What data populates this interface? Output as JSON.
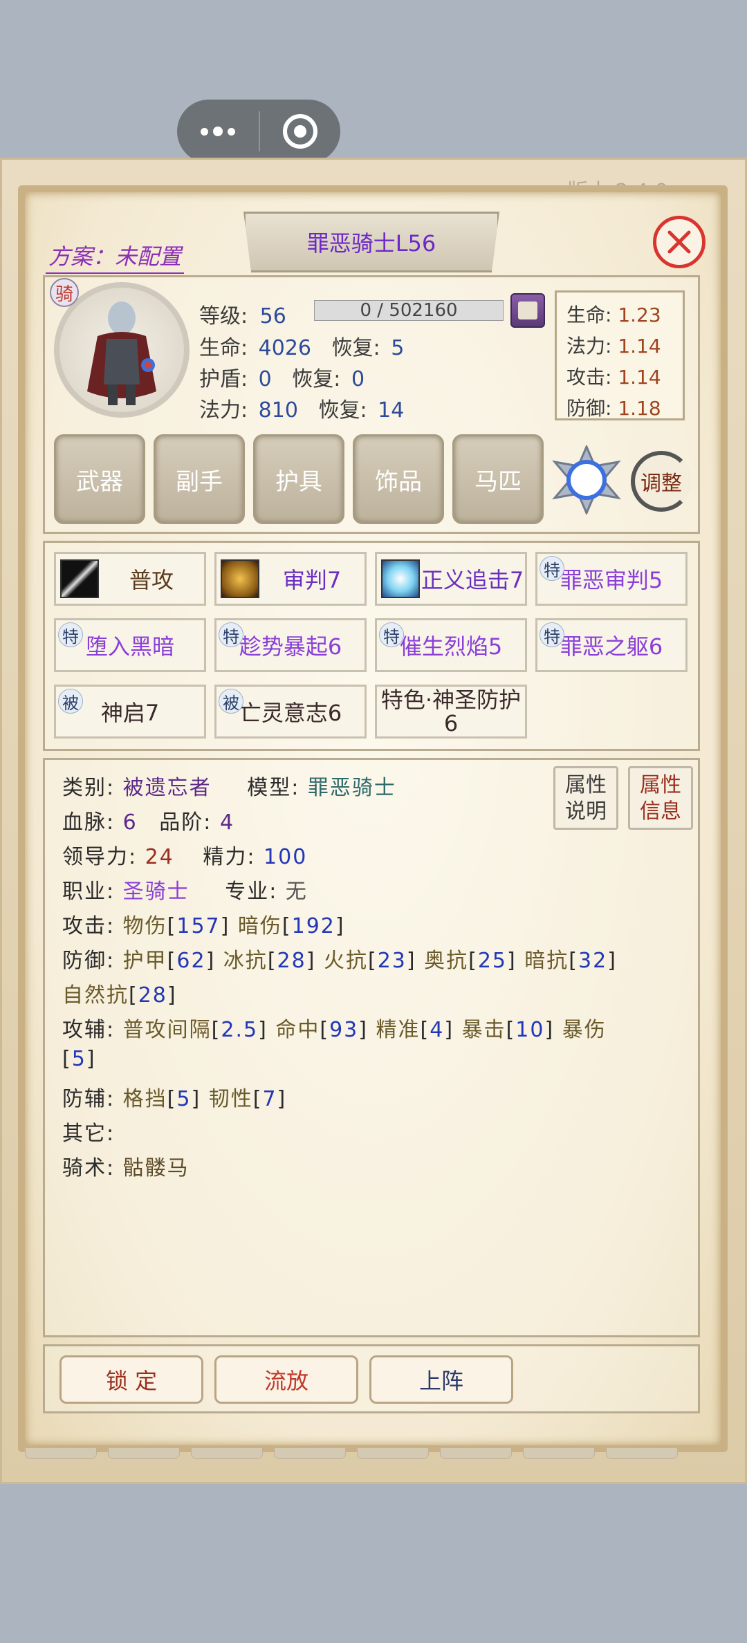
{
  "version_hint": "版本 2.4.0",
  "title": "罪恶骑士L56",
  "plan_label": "方案：未配置",
  "class_badge": "骑",
  "stats": {
    "level_label": "等级:",
    "level": "56",
    "exp": "0 / 502160",
    "hp_label": "生命:",
    "hp": "4026",
    "hp_regen_label": "恢复:",
    "hp_regen": "5",
    "shield_label": "护盾:",
    "shield": "0",
    "shield_regen_label": "恢复:",
    "shield_regen": "0",
    "mp_label": "法力:",
    "mp": "810",
    "mp_regen_label": "恢复:",
    "mp_regen": "14"
  },
  "growth": [
    {
      "label": "生命:",
      "value": "1.23"
    },
    {
      "label": "法力:",
      "value": "1.14"
    },
    {
      "label": "攻击:",
      "value": "1.14"
    },
    {
      "label": "防御:",
      "value": "1.18"
    }
  ],
  "equipment": [
    "武器",
    "副手",
    "护具",
    "饰品",
    "马匹"
  ],
  "adjust_label": "调整",
  "skills": [
    {
      "tag": "",
      "icon": "sword-icon",
      "label": "普攻"
    },
    {
      "tag": "",
      "icon": "judgement-icon",
      "label": "审判7"
    },
    {
      "tag": "",
      "icon": "justice-icon",
      "label": "正义追击7"
    },
    {
      "tag": "特",
      "icon": "",
      "label": "罪恶审判5"
    },
    {
      "tag": "特",
      "icon": "",
      "label": "堕入黑暗"
    },
    {
      "tag": "特",
      "icon": "",
      "label": "趁势暴起6"
    },
    {
      "tag": "特",
      "icon": "",
      "label": "催生烈焰5"
    },
    {
      "tag": "特",
      "icon": "",
      "label": "罪恶之躯6"
    },
    {
      "tag": "被",
      "icon": "",
      "label": "神启7"
    },
    {
      "tag": "被",
      "icon": "",
      "label": "亡灵意志6"
    },
    {
      "tag": "",
      "icon": "",
      "label": "特色·神圣防护",
      "label2": "6"
    }
  ],
  "info": {
    "category_label": "类别:",
    "category": "被遗忘者",
    "model_label": "模型:",
    "model": "罪恶骑士",
    "blood_label": "血脉:",
    "blood": "6",
    "grade_label": "品阶:",
    "grade": "4",
    "leadership_label": "领导力:",
    "leadership": "24",
    "energy_label": "精力:",
    "energy": "100",
    "job_label": "职业:",
    "job": "圣骑士",
    "spec_label": "专业:",
    "spec": "无",
    "attack_label": "攻击:",
    "phys_label": "物伤",
    "phys": "157",
    "dark_label": "暗伤",
    "dark": "192",
    "defense_label": "防御:",
    "armor_label": "护甲",
    "armor": "62",
    "ice_label": "冰抗",
    "ice": "28",
    "fire_label": "火抗",
    "fire": "23",
    "arcane_label": "奥抗",
    "arcane": "25",
    "darkres_label": "暗抗",
    "darkres": "32",
    "nature_label": "自然抗",
    "nature": "28",
    "atk_aux_label": "攻辅:",
    "interval_label": "普攻间隔",
    "interval": "2.5",
    "hit_label": "命中",
    "hit": "93",
    "precise_label": "精准",
    "precise": "4",
    "crit_label": "暴击",
    "crit": "10",
    "critdmg_label": "暴伤",
    "critdmg": "5",
    "def_aux_label": "防辅:",
    "block_label": "格挡",
    "block": "5",
    "tough_label": "韧性",
    "tough": "7",
    "other_label": "其它:",
    "riding_label": "骑术:",
    "riding": "骷髅马"
  },
  "attr_buttons": {
    "explain_1": "属性",
    "explain_2": "说明",
    "info_1": "属性",
    "info_2": "信息"
  },
  "buttons": {
    "lock": "锁 定",
    "exile": "流放",
    "deploy": "上阵"
  },
  "colors": {
    "accent_purple": "#6a2fc0",
    "close_red": "#d8352e",
    "parchment": "#f4ead3"
  }
}
